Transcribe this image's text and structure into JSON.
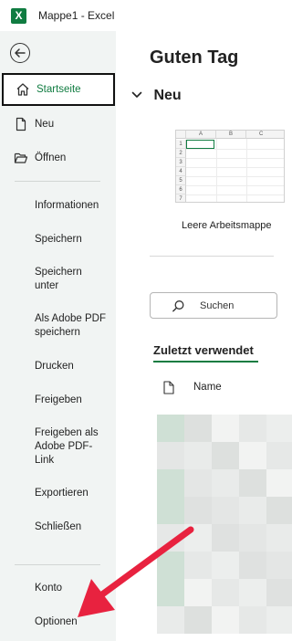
{
  "window": {
    "app_logo": "X",
    "title": "Mappe1  -  Excel"
  },
  "sidebar": {
    "back_icon": "back-arrow-icon",
    "nav": [
      {
        "label": "Startseite",
        "icon": "home-icon",
        "active": true
      },
      {
        "label": "Neu",
        "icon": "new-document-icon",
        "active": false
      },
      {
        "label": "Öffnen",
        "icon": "folder-open-icon",
        "active": false
      }
    ],
    "menu": [
      "Informationen",
      "Speichern",
      "Speichern unter",
      "Als Adobe PDF speichern",
      "Drucken",
      "Freigeben",
      "Freigeben als Adobe PDF-Link",
      "Exportieren",
      "Schließen"
    ],
    "bottom": [
      "Konto",
      "Optionen"
    ]
  },
  "main": {
    "greeting": "Guten Tag",
    "new_section": "Neu",
    "template": {
      "columns": [
        "A",
        "B",
        "C"
      ],
      "rows": [
        "1",
        "2",
        "3",
        "4",
        "5",
        "6",
        "7"
      ],
      "label": "Leere Arbeitsmappe"
    },
    "search": {
      "placeholder": "Suchen",
      "value": ""
    },
    "recent_tab": "Zuletzt verwendet",
    "list_header": {
      "name": "Name"
    }
  },
  "colors": {
    "accent": "#107c41",
    "sidebar_bg": "#f1f4f3",
    "annotation_arrow": "#e8223f"
  }
}
